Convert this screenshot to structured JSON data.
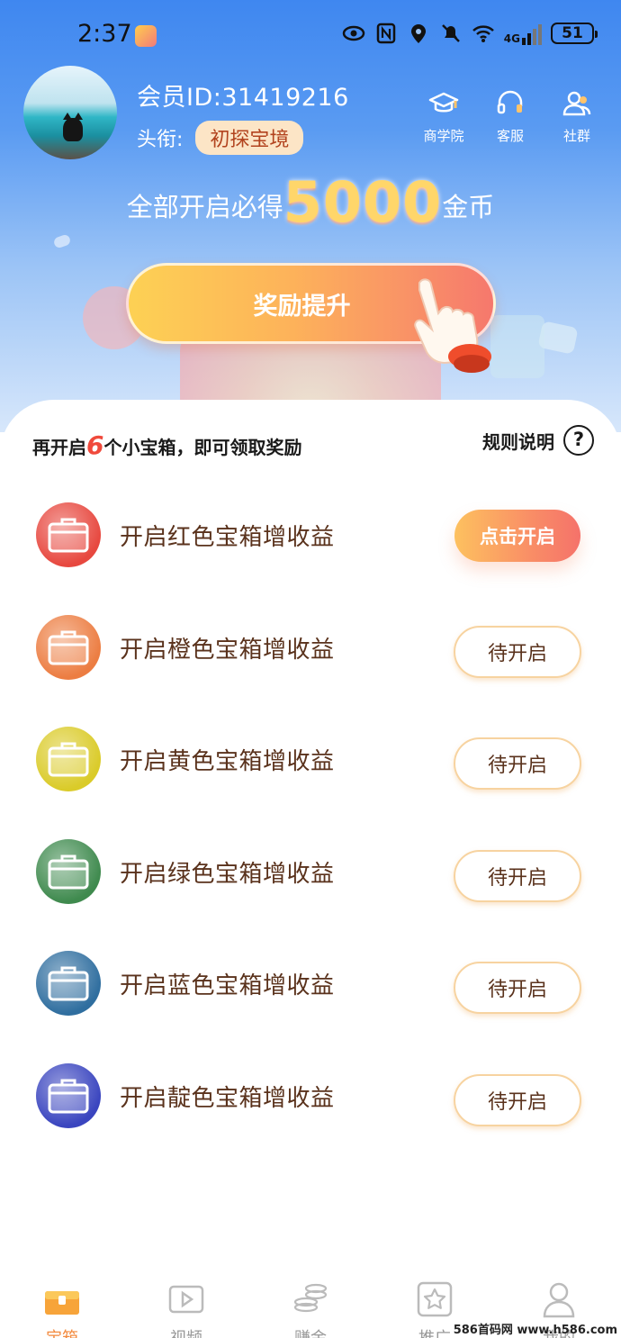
{
  "status_bar": {
    "time": "2:37",
    "network": "4G",
    "battery": "51"
  },
  "profile": {
    "member_id": "会员ID:31419216",
    "title_label": "头衔:",
    "title_badge": "初探宝境"
  },
  "top_links": [
    {
      "label": "商学院",
      "icon": "graduation-cap-icon"
    },
    {
      "label": "客服",
      "icon": "headset-icon"
    },
    {
      "label": "社群",
      "icon": "people-icon"
    }
  ],
  "headline": {
    "prefix": "全部开启必得",
    "amount": "5000",
    "suffix": "金币"
  },
  "boost_button": "奖励提升",
  "tip": {
    "prefix": "再开启",
    "count": "6",
    "suffix": "个小宝箱，即可领取奖励"
  },
  "rules": {
    "label": "规则说明",
    "icon": "?"
  },
  "boxes": [
    {
      "label": "开启红色宝箱增收益",
      "action": "点击开启",
      "state": "open",
      "color": "#e7483f"
    },
    {
      "label": "开启橙色宝箱增收益",
      "action": "待开启",
      "state": "waiting",
      "color": "#ec7d42"
    },
    {
      "label": "开启黄色宝箱增收益",
      "action": "待开启",
      "state": "waiting",
      "color": "#dacb29"
    },
    {
      "label": "开启绿色宝箱增收益",
      "action": "待开启",
      "state": "waiting",
      "color": "#3f8a4e"
    },
    {
      "label": "开启蓝色宝箱增收益",
      "action": "待开启",
      "state": "waiting",
      "color": "#2f6e9f"
    },
    {
      "label": "开启靛色宝箱增收益",
      "action": "待开启",
      "state": "waiting",
      "color": "#3a45bf"
    }
  ],
  "bottom_nav": [
    {
      "label": "宝箱",
      "icon": "treasure-box-icon",
      "active": true
    },
    {
      "label": "视频",
      "icon": "video-icon",
      "active": false
    },
    {
      "label": "赚金",
      "icon": "coins-icon",
      "active": false
    },
    {
      "label": "推广",
      "icon": "star-icon",
      "active": false
    },
    {
      "label": "我的",
      "icon": "user-icon",
      "active": false
    }
  ],
  "watermark": "586首码网 www.h586.com"
}
